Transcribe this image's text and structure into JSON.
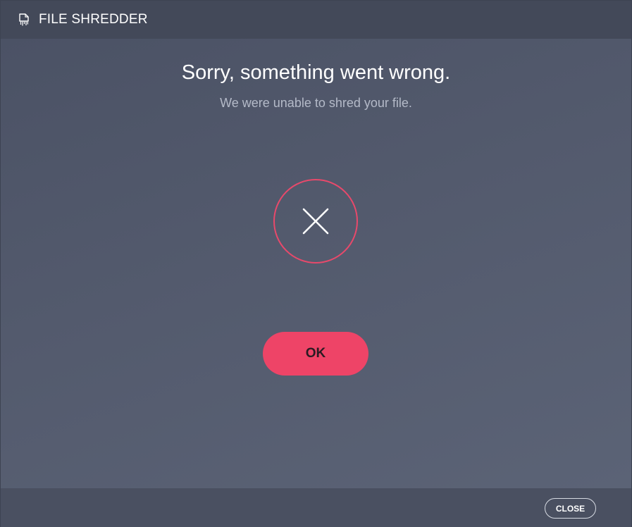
{
  "window": {
    "title": "FILE SHREDDER",
    "title_icon": "shredder-icon"
  },
  "message": {
    "heading": "Sorry, something went wrong.",
    "subheading": "We were unable to shred your file.",
    "status_icon": "error-x-icon"
  },
  "actions": {
    "ok_label": "OK",
    "close_label": "CLOSE"
  },
  "colors": {
    "accent": "#ee4467",
    "background": "#535a6d",
    "titlebar": "#434959"
  }
}
